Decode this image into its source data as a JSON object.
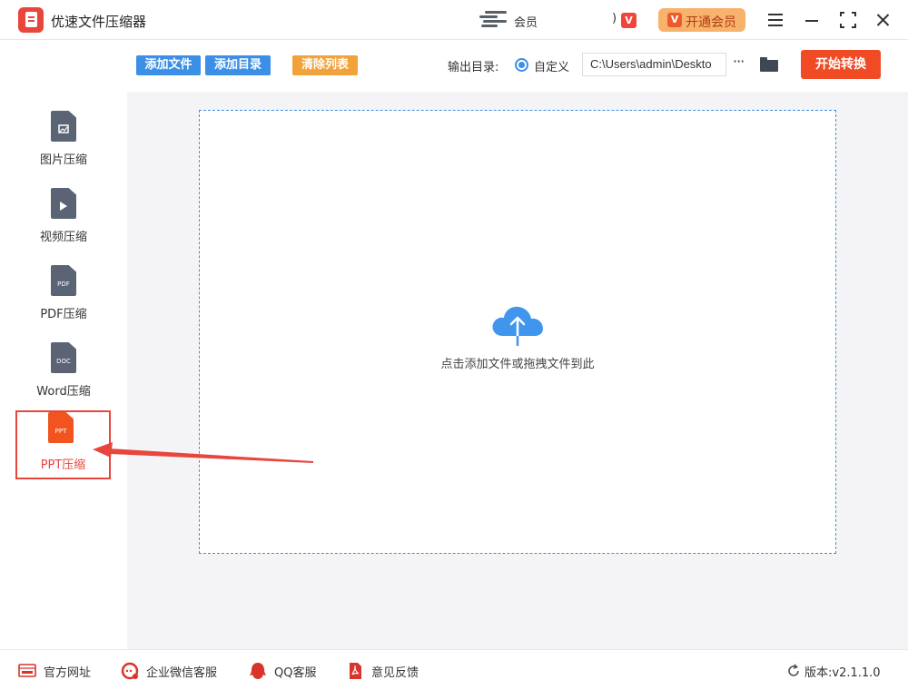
{
  "app": {
    "title": "优速文件压缩器"
  },
  "header": {
    "member_text": "会员",
    "paren_glyph": ")",
    "vip_badge": "V",
    "open_vip_label": "开通会员"
  },
  "sidebar": {
    "items": [
      {
        "label": "图片压缩",
        "icon": "image-file-icon",
        "tag": ""
      },
      {
        "label": "视频压缩",
        "icon": "video-file-icon",
        "tag": ""
      },
      {
        "label": "PDF压缩",
        "icon": "pdf-file-icon",
        "tag": "PDF"
      },
      {
        "label": "Word压缩",
        "icon": "doc-file-icon",
        "tag": "DOC"
      },
      {
        "label": "PPT压缩",
        "icon": "ppt-file-icon",
        "tag": "PPT",
        "active": true
      }
    ]
  },
  "toolbar": {
    "add_file": "添加文件",
    "add_dir": "添加目录",
    "clear_list": "清除列表",
    "output_label": "输出目录:",
    "custom_option": "自定义",
    "output_path": "C:\\Users\\admin\\Deskto",
    "more": "···",
    "start": "开始转换"
  },
  "dropzone": {
    "hint": "点击添加文件或拖拽文件到此"
  },
  "footer": {
    "website": "官方网址",
    "wechat_service": "企业微信客服",
    "qq_service": "QQ客服",
    "feedback": "意见反馈",
    "version_label": "版本:",
    "version": "v2.1.1.0"
  },
  "colors": {
    "accent_blue": "#3c8fe6",
    "accent_orange": "#f2a23a",
    "start_red": "#f04b25",
    "highlight_red": "#e8453c",
    "vip_gold": "#f7b36b"
  }
}
